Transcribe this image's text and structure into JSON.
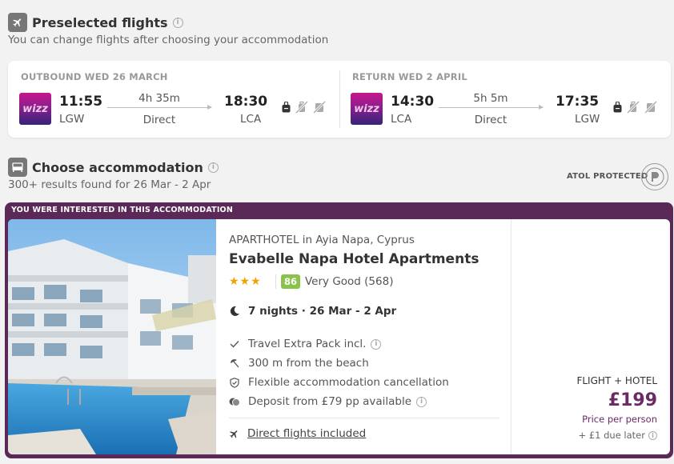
{
  "preselected": {
    "title": "Preselected flights",
    "subtitle": "You can change flights after choosing your accommodation"
  },
  "outbound": {
    "label": "OUTBOUND WED 26 MARCH",
    "airline_logo_text": "wizz",
    "depart_time": "11:55",
    "depart_airport": "LGW",
    "duration": "4h 35m",
    "flight_type": "Direct",
    "arrive_time": "18:30",
    "arrive_airport": "LCA"
  },
  "return": {
    "label": "RETURN WED 2 APRIL",
    "airline_logo_text": "wizz",
    "depart_time": "14:30",
    "depart_airport": "LCA",
    "duration": "5h 5m",
    "flight_type": "Direct",
    "arrive_time": "17:35",
    "arrive_airport": "LGW"
  },
  "accommodation_section": {
    "title": "Choose accommodation",
    "subtitle": "300+ results found for 26 Mar - 2 Apr",
    "atol_label": "ATOL PROTECTED"
  },
  "hotel": {
    "banner": "YOU WERE INTERESTED IN THIS ACCOMMODATION",
    "type_location": "APARTHOTEL in Ayia Napa, Cyprus",
    "name": "Evabelle Napa Hotel Apartments",
    "stars": "★★★",
    "score": "86",
    "score_label": "Very Good (568)",
    "nights": "7 nights · 26 Mar - 2 Apr",
    "features": [
      "Travel Extra Pack incl.",
      "300 m from the beach",
      "Flexible accommodation cancellation",
      "Deposit from £79 pp available"
    ],
    "direct_flights": "Direct flights included"
  },
  "price": {
    "label": "FLIGHT + HOTEL",
    "amount": "£199",
    "per": "Price per person",
    "due_later": "+ £1 due later"
  },
  "colors": {
    "accent_purple": "#5b2958",
    "price_purple": "#6b2a65",
    "score_green": "#8bc34a",
    "star_orange": "#f2a200"
  }
}
